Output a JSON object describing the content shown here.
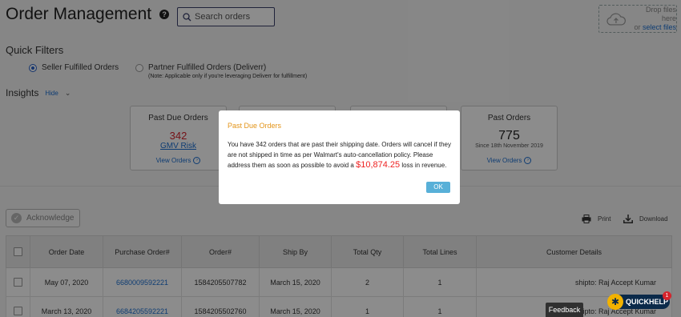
{
  "header": {
    "title": "Order Management",
    "help_icon": "?",
    "search_placeholder": "Search orders",
    "dropzone": {
      "line1": "Drop files here",
      "line2_prefix": "or ",
      "line2_link": "select files"
    }
  },
  "quick_filters": {
    "title": "Quick Filters",
    "seller_label": "Seller Fulfilled Orders",
    "partner_label": "Partner Fulfilled Orders (Deliverr)",
    "partner_note": "(Note: Applicable only if you're leveraging Deliverr for fulfillment)",
    "selected": "seller"
  },
  "insights": {
    "title": "Insights",
    "hide_label": "Hide",
    "toggle_glyph": "⌄"
  },
  "cards": {
    "past_due": {
      "title": "Past Due Orders",
      "count": "342",
      "sub": "GMV Risk",
      "link": "View Orders"
    },
    "past_orders": {
      "title": "Past Orders",
      "count": "775",
      "since": "Since 18th November 2019",
      "link": "View Orders"
    }
  },
  "toolbar": {
    "acknowledge": "Acknowledge",
    "print": "Print",
    "download": "Download"
  },
  "table": {
    "headers": [
      "Order Date",
      "Purchase Order#",
      "Order#",
      "Ship By",
      "Total Qty",
      "Total Lines",
      "Customer Details"
    ],
    "rows": [
      [
        "May 07, 2020",
        "6680009592221",
        "1584205507782",
        "March 15, 2020",
        "2",
        "1",
        "shipto: Raj Accept Kumar"
      ],
      [
        "March 13, 2020",
        "6684205592221",
        "1584205502760",
        "March 15, 2020",
        "1",
        "1",
        "shipto: Raj Accept Kumar"
      ]
    ]
  },
  "modal": {
    "title": "Past Due Orders",
    "body_before": "You have 342 orders that are past their shipping date. Orders will cancel if they are not shipped in time as per Walmart's auto-cancellation policy. Please address them as soon as possible to avoid a ",
    "loss_amount": "$10,874.25",
    "body_after": " loss in revenue.",
    "ok_label": "OK"
  },
  "footer": {
    "feedback": "Feedback",
    "quickhelp": "QUICKHELP",
    "quickhelp_badge": "1"
  },
  "colors": {
    "accent_blue": "#1a6ed1",
    "danger_red": "#d6242c",
    "modal_title": "#e39418",
    "ok_button": "#58b0d8"
  }
}
